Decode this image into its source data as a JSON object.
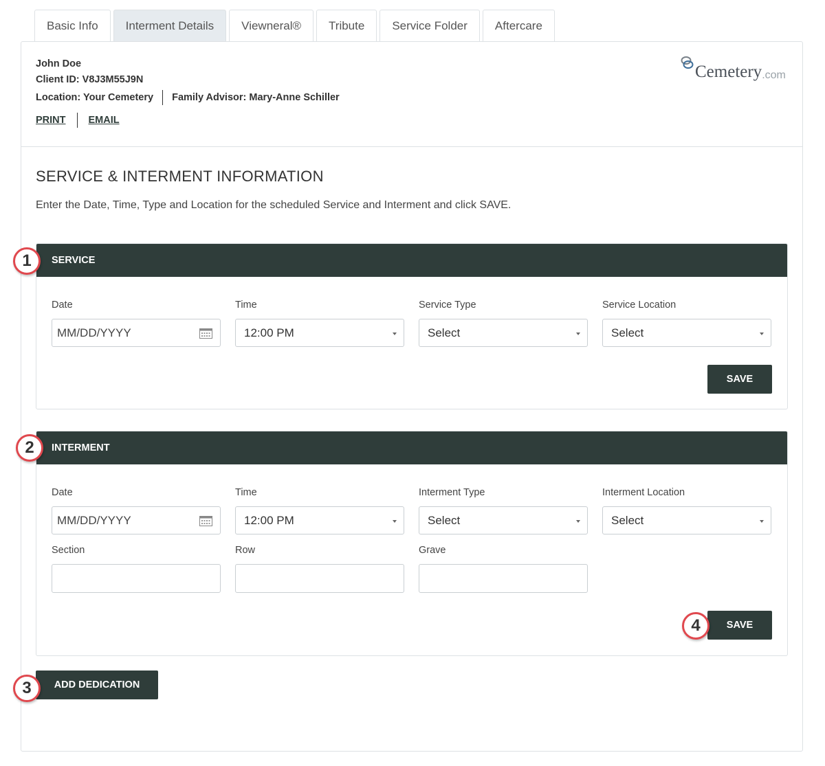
{
  "tabs": [
    {
      "label": "Basic Info"
    },
    {
      "label": "Interment Details",
      "active": true
    },
    {
      "label": "Viewneral®"
    },
    {
      "label": "Tribute"
    },
    {
      "label": "Service Folder"
    },
    {
      "label": "Aftercare"
    }
  ],
  "client": {
    "name": "John Doe",
    "client_id": "Client ID: V8J3M55J9N",
    "location": "Location: Your Cemetery",
    "advisor": "Family Advisor: Mary-Anne Schiller"
  },
  "actions": {
    "print": "PRINT",
    "email": "EMAIL"
  },
  "logo": {
    "word": "Cemetery",
    "domain": ".com"
  },
  "section": {
    "title": "SERVICE & INTERMENT INFORMATION",
    "description": "Enter the Date, Time, Type and Location for the scheduled Service and Interment and click SAVE."
  },
  "service": {
    "header": "SERVICE",
    "date_label": "Date",
    "date_placeholder": "MM/DD/YYYY",
    "time_label": "Time",
    "time_value": "12:00 PM",
    "type_label": "Service Type",
    "type_value": "Select",
    "location_label": "Service Location",
    "location_value": "Select",
    "save": "SAVE"
  },
  "interment": {
    "header": "INTERMENT",
    "date_label": "Date",
    "date_placeholder": "MM/DD/YYYY",
    "time_label": "Time",
    "time_value": "12:00 PM",
    "type_label": "Interment Type",
    "type_value": "Select",
    "location_label": "Interment Location",
    "location_value": "Select",
    "section_label": "Section",
    "row_label": "Row",
    "grave_label": "Grave",
    "save": "SAVE"
  },
  "add_dedication": "ADD DEDICATION",
  "badges": [
    "1",
    "2",
    "3",
    "4"
  ],
  "colors": {
    "accent": "#2f3d3a",
    "badge_border": "#e0484e",
    "tab_active_bg": "#e6ebef"
  }
}
